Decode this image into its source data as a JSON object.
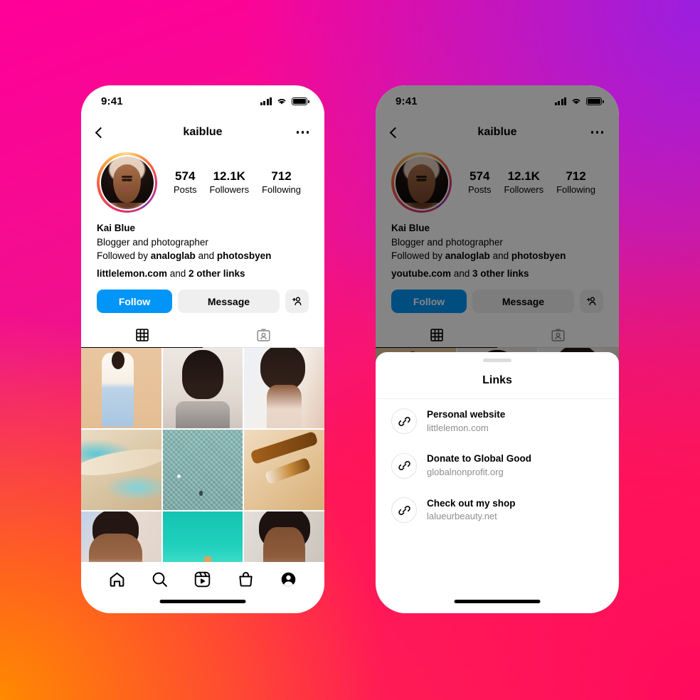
{
  "background": {
    "colors": [
      "#FF0099",
      "#9B1FE0",
      "#FF8A00",
      "#FF0A5E"
    ]
  },
  "accent": {
    "follow_blue": "#0095F6",
    "button_gray": "#EFEFEF",
    "muted_text": "#8E8E8E"
  },
  "phones": [
    {
      "id": "left",
      "status": {
        "time": "9:41",
        "signal_icon": "cellular-bars-icon",
        "wifi_icon": "wifi-icon",
        "battery_icon": "battery-icon"
      },
      "nav": {
        "back_icon": "back-chevron-icon",
        "title": "kaiblue",
        "more_icon": "more-options-icon"
      },
      "profile": {
        "avatar": "profile-avatar",
        "stats": [
          {
            "value": "574",
            "label": "Posts"
          },
          {
            "value": "12.1K",
            "label": "Followers"
          },
          {
            "value": "712",
            "label": "Following"
          }
        ]
      },
      "bio": {
        "name": "Kai Blue",
        "description": "Blogger and photographer",
        "followed_by_prefix": "Followed by ",
        "followed_by_1": "analoglab",
        "followed_by_join": " and ",
        "followed_by_2": "photosbyen",
        "link_primary": "littlelemon.com",
        "link_join": " and ",
        "link_more": "2 other links"
      },
      "actions": {
        "follow": "Follow",
        "message": "Message",
        "add_user_icon": "add-user-icon"
      },
      "tabs": [
        {
          "icon": "grid-icon",
          "active": true
        },
        {
          "icon": "tagged-icon",
          "active": false
        }
      ],
      "grid": [
        "photo-woman-white-coat",
        "photo-woman-cooking-pot",
        "photo-woman-portrait-pink-headband",
        "photo-abstract-sand-waves",
        "photo-aerial-green-water",
        "photo-oil-bottles-flatlay",
        "photo-woman-headband-selfie",
        "photo-coastal-turquoise-sea",
        "photo-woman-portrait-bathroom"
      ],
      "tabbar": [
        {
          "icon": "home-icon",
          "active": false
        },
        {
          "icon": "search-icon",
          "active": false
        },
        {
          "icon": "reels-icon",
          "active": false
        },
        {
          "icon": "shop-icon",
          "active": false
        },
        {
          "icon": "profile-icon",
          "active": true
        }
      ]
    },
    {
      "id": "right",
      "dimmed": true,
      "status": {
        "time": "9:41",
        "signal_icon": "cellular-bars-icon",
        "wifi_icon": "wifi-icon",
        "battery_icon": "battery-icon"
      },
      "nav": {
        "back_icon": "back-chevron-icon",
        "title": "kaiblue",
        "more_icon": "more-options-icon"
      },
      "profile": {
        "avatar": "profile-avatar",
        "stats": [
          {
            "value": "574",
            "label": "Posts"
          },
          {
            "value": "12.1K",
            "label": "Followers"
          },
          {
            "value": "712",
            "label": "Following"
          }
        ]
      },
      "bio": {
        "name": "Kai Blue",
        "description": "Blogger and photographer",
        "followed_by_prefix": "Followed by ",
        "followed_by_1": "analoglab",
        "followed_by_join": " and ",
        "followed_by_2": "photosbyen",
        "link_primary": "youtube.com",
        "link_join": " and ",
        "link_more": "3 other links"
      },
      "actions": {
        "follow": "Follow",
        "message": "Message",
        "add_user_icon": "add-user-icon"
      },
      "tabs": [
        {
          "icon": "grid-icon",
          "active": true
        },
        {
          "icon": "tagged-icon",
          "active": false
        }
      ],
      "sheet": {
        "handle": "sheet-grab-handle",
        "title": "Links",
        "items": [
          {
            "icon": "link-icon",
            "title": "Personal website",
            "url": "littlelemon.com"
          },
          {
            "icon": "link-icon",
            "title": "Donate to Global Good",
            "url": "globalnonprofit.org"
          },
          {
            "icon": "link-icon",
            "title": "Check out my shop",
            "url": "lalueurbeauty.net"
          }
        ]
      }
    }
  ]
}
